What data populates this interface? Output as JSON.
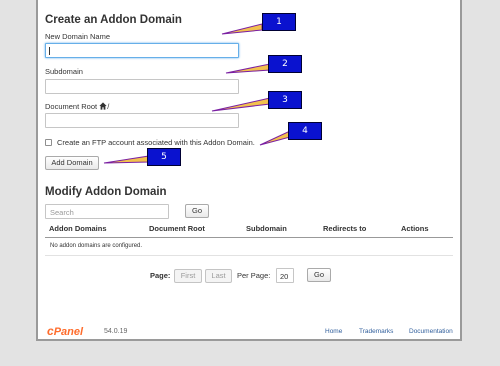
{
  "create_section": {
    "title": "Create an Addon Domain",
    "new_domain_label": "New Domain Name",
    "new_domain_value": "",
    "subdomain_label": "Subdomain",
    "subdomain_value": "",
    "docroot_label_prefix": "Document Root",
    "docroot_label_suffix": "/",
    "docroot_icon": "home-icon",
    "docroot_value": "",
    "ftp_checkbox_label": "Create an FTP account associated with this Addon Domain.",
    "ftp_checked": false,
    "add_button": "Add Domain"
  },
  "modify_section": {
    "title": "Modify Addon Domain",
    "search_placeholder": "Search",
    "go_button": "Go",
    "columns": [
      "Addon Domains",
      "Document Root",
      "Subdomain",
      "Redirects to",
      "Actions"
    ],
    "empty_message": "No addon domains are configured."
  },
  "pagination": {
    "page_label": "Page:",
    "first": "First",
    "last": "Last",
    "per_page_label": "Per Page:",
    "per_page_value": "20",
    "go_button": "Go"
  },
  "footer": {
    "logo_c": "c",
    "logo_rest": "Panel",
    "version": "54.0.19",
    "links": [
      "Home",
      "Trademarks",
      "Documentation"
    ]
  },
  "callouts": [
    "1",
    "2",
    "3",
    "4",
    "5"
  ],
  "colors": {
    "callout_fill": "#0a12cf",
    "pointer_fill": "#f2c14e",
    "pointer_edge": "#7a1fa2",
    "brand_orange": "#ff6c2c",
    "link_blue": "#315f9c",
    "focus_blue": "#66afe9"
  }
}
